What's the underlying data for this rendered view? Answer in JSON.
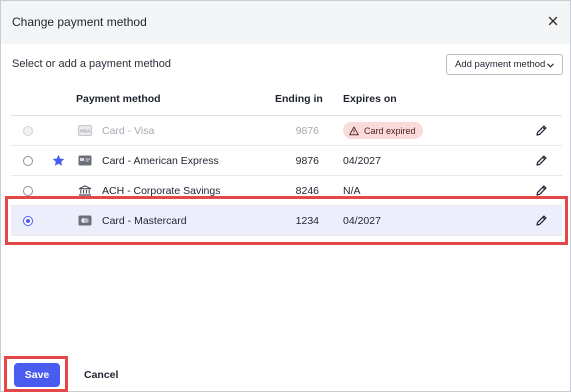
{
  "dialog": {
    "title": "Change payment method",
    "close_icon": "close-icon"
  },
  "subtitle": "Select or add a payment method",
  "add_button": {
    "label": "Add payment method",
    "icon": "chevron-down-icon"
  },
  "table": {
    "headers": {
      "method": "Payment method",
      "ending": "Ending in",
      "expires": "Expires on"
    },
    "rows": [
      {
        "name": "Card - Visa",
        "icon": "visa-card-icon",
        "ending": "9876",
        "expires": "",
        "badge": "Card expired",
        "disabled": true,
        "default": false,
        "selected": false
      },
      {
        "name": "Card - American Express",
        "icon": "card-icon",
        "ending": "9876",
        "expires": "04/2027",
        "badge": "",
        "disabled": false,
        "default": true,
        "selected": false
      },
      {
        "name": "ACH - Corporate Savings",
        "icon": "bank-icon",
        "ending": "8246",
        "expires": "N/A",
        "badge": "",
        "disabled": false,
        "default": false,
        "selected": false
      },
      {
        "name": "Card - Mastercard",
        "icon": "mastercard-icon",
        "ending": "1234",
        "expires": "04/2027",
        "badge": "",
        "disabled": false,
        "default": false,
        "selected": true
      }
    ]
  },
  "footer": {
    "save_label": "Save",
    "cancel_label": "Cancel"
  },
  "colors": {
    "accent": "#4a5cf0",
    "highlight": "#e34747",
    "expired_badge": "#fbdada",
    "selected_row": "#eceefc"
  }
}
